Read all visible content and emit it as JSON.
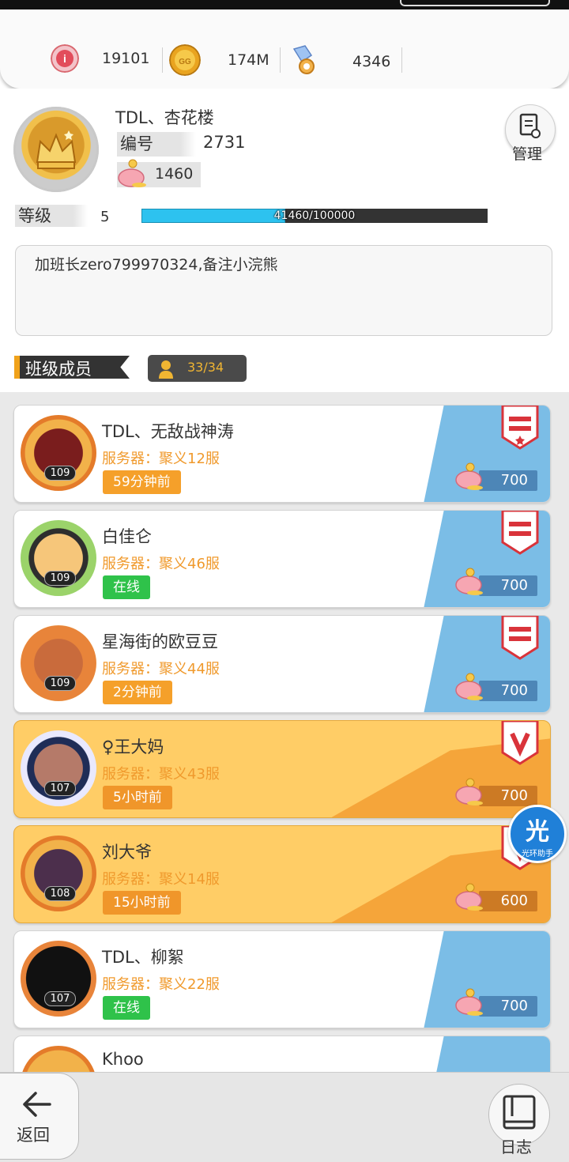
{
  "currency": [
    {
      "icon": "red-crystal-coin-icon",
      "value": "19101"
    },
    {
      "icon": "gold-coin-icon",
      "value": "174M"
    },
    {
      "icon": "pacifier-gem-icon",
      "value": "4346"
    }
  ],
  "profile": {
    "name": "TDL、杏花楼",
    "id_label": "编号",
    "id_value": "2731",
    "piggy_value": "1460",
    "manage_label": "管理",
    "level_label": "等级",
    "level_value": "5",
    "exp_text": "41460/100000",
    "exp_progress": 0.4146,
    "notice": "加班长zero799970324,备注小浣熊"
  },
  "members": {
    "title": "班级成员",
    "count": "33/34",
    "list": [
      {
        "name": "TDL、无敌战神涛",
        "server": "服务器：聚义12服",
        "status": "59分钟前",
        "status_color": "orange",
        "level": "109",
        "points": "700",
        "rank_icon": "red-rank-star-badge-icon",
        "theme": "white"
      },
      {
        "name": "白佳仑",
        "server": "服务器：聚义46服",
        "status": "在线",
        "status_color": "green",
        "level": "109",
        "points": "700",
        "rank_icon": "red-rank-badge-icon",
        "theme": "white"
      },
      {
        "name": "星海街的欧豆豆",
        "server": "服务器：聚义44服",
        "status": "2分钟前",
        "status_color": "orange",
        "level": "109",
        "points": "700",
        "rank_icon": "red-rank-badge-icon",
        "theme": "white"
      },
      {
        "name": "♀王大妈",
        "server": "服务器：聚义43服",
        "status": "5小时前",
        "status_color": "orange",
        "level": "107",
        "points": "700",
        "rank_icon": "red-v-badge-icon",
        "theme": "gold"
      },
      {
        "name": "刘大爷",
        "server": "服务器：聚义14服",
        "status": "15小时前",
        "status_color": "orange",
        "level": "108",
        "points": "600",
        "rank_icon": "red-v-badge-icon",
        "theme": "gold"
      },
      {
        "name": "TDL、柳絮",
        "server": "服务器：聚义22服",
        "status": "在线",
        "status_color": "green",
        "level": "107",
        "points": "700",
        "rank_icon": "",
        "theme": "white"
      },
      {
        "name": "Khoo",
        "server": "",
        "status": "",
        "status_color": "",
        "level": "",
        "points": "",
        "rank_icon": "",
        "theme": "white"
      }
    ]
  },
  "floating": {
    "halo_big": "光",
    "halo_small": "光环助手"
  },
  "bottom": {
    "back_label": "返回",
    "log_label": "日志"
  }
}
